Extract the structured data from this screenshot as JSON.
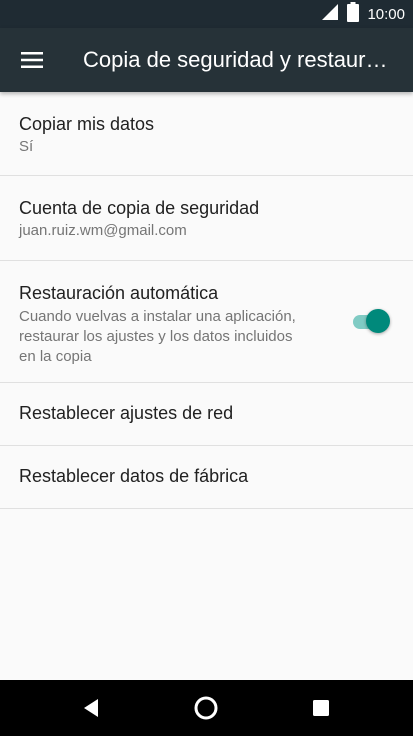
{
  "status_bar": {
    "time": "10:00",
    "icons": [
      "signal-icon",
      "battery-icon"
    ]
  },
  "app_bar": {
    "title": "Copia de seguridad y restaur…",
    "menu_icon": "menu-icon"
  },
  "settings": {
    "copy_data": {
      "title": "Copiar mis datos",
      "value": "Sí"
    },
    "backup_account": {
      "title": "Cuenta de copia de seguridad",
      "value": "juan.ruiz.wm@gmail.com"
    },
    "auto_restore": {
      "title": "Restauración automática",
      "desc_line1": "Cuando vuelvas a instalar una aplicación,",
      "desc_line2": "restaurar los ajustes y los datos incluidos",
      "desc_line3": "en la copia",
      "toggle_on": true
    },
    "reset_network": {
      "title": "Restablecer ajustes de red"
    },
    "factory_reset": {
      "title": "Restablecer datos de fábrica"
    }
  },
  "nav_bar": {
    "icons": [
      "back-icon",
      "home-icon",
      "recents-icon"
    ]
  },
  "colors": {
    "app_bar": "#263238",
    "status_bar": "#1f2b33",
    "accent": "#00897b",
    "accent_track": "#80cbc4"
  }
}
